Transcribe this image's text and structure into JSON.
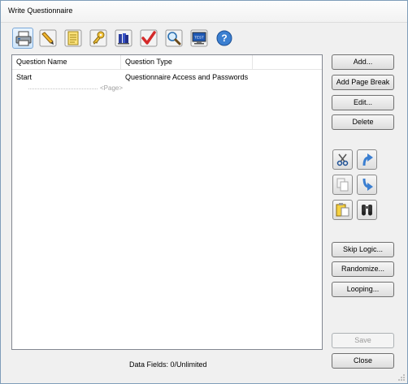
{
  "window": {
    "title": "Write Questionnaire"
  },
  "toolbar": {
    "icons": [
      "printer-icon",
      "pencil-icon",
      "notepad-icon",
      "key-icon",
      "library-icon",
      "checkmark-icon",
      "magnifier-icon",
      "test-monitor-icon",
      "help-icon"
    ],
    "monitor_label": "TEST",
    "help_label": "?"
  },
  "list": {
    "columns": [
      "Question Name",
      "Question Type"
    ],
    "rows": [
      {
        "name": "Start",
        "type": "Questionnaire Access and Passwords"
      }
    ],
    "page_marker": "<Page>"
  },
  "buttons": {
    "add": "Add...",
    "add_page_break": "Add Page Break",
    "edit": "Edit...",
    "delete": "Delete",
    "skip_logic": "Skip Logic...",
    "randomize": "Randomize...",
    "looping": "Looping...",
    "save": "Save",
    "close": "Close"
  },
  "edit_tools": [
    "cut-icon",
    "move-up-icon",
    "copy-icon",
    "move-down-icon",
    "paste-icon",
    "find-icon"
  ],
  "status": {
    "data_fields": "Data Fields: 0/Unlimited"
  },
  "colors": {
    "accent_blue": "#3b7fd1",
    "check_red": "#d42a2a",
    "folder_yellow": "#f5d142"
  }
}
